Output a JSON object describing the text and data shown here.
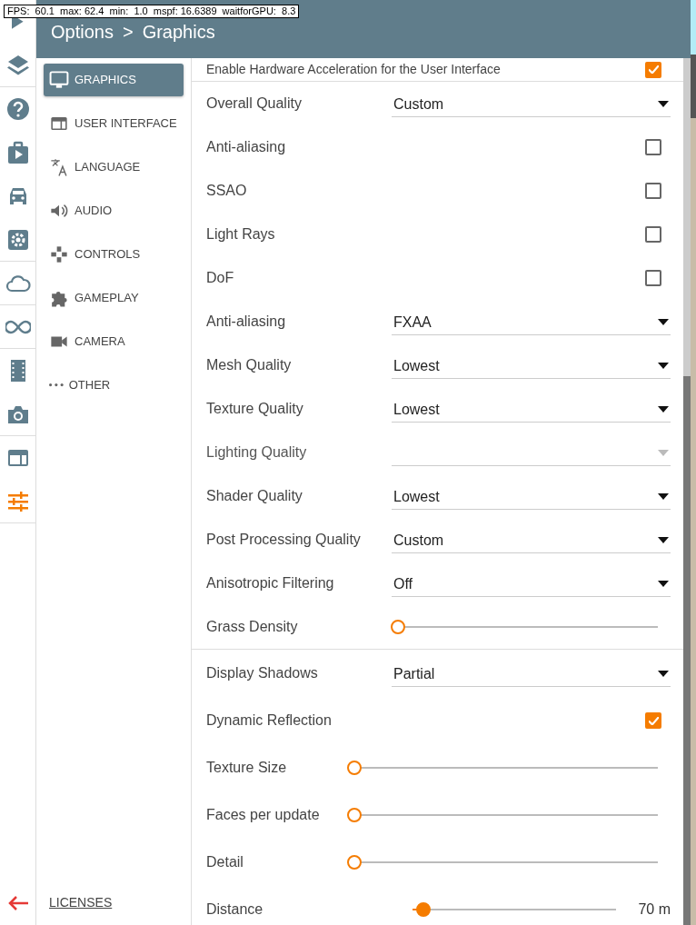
{
  "fps_overlay": "FPS:  60.1  max: 62.4  min:  1.0  mspf: 16.6389  waitforGPU:  8.3",
  "header": {
    "title": "Options",
    "separator": ">",
    "subtitle": "Graphics"
  },
  "rail": [
    {
      "selected": false
    },
    {
      "selected": false
    },
    {
      "selected": false
    },
    {
      "selected": false
    },
    {
      "selected": false
    },
    {
      "selected": false
    },
    {
      "selected": false
    },
    {
      "selected": false
    },
    {
      "selected": false
    },
    {
      "selected": false
    },
    {
      "selected": false
    },
    {
      "selected": true
    }
  ],
  "menu": [
    {
      "label": "GRAPHICS",
      "selected": true
    },
    {
      "label": "USER INTERFACE",
      "selected": false
    },
    {
      "label": "LANGUAGE",
      "selected": false
    },
    {
      "label": "AUDIO",
      "selected": false
    },
    {
      "label": "CONTROLS",
      "selected": false
    },
    {
      "label": "GAMEPLAY",
      "selected": false
    },
    {
      "label": "CAMERA",
      "selected": false
    },
    {
      "label": "OTHER",
      "selected": false
    }
  ],
  "licenses": "LICENSES",
  "sections": [
    {
      "settings": [
        {
          "kind": "checkbox",
          "label": "Enable Hardware Acceleration for the User Interface",
          "checked": true
        },
        {
          "kind": "select",
          "label": "Overall Quality",
          "value": "Custom",
          "disabled": false
        },
        {
          "kind": "checkbox",
          "label": "Anti-aliasing",
          "checked": false
        },
        {
          "kind": "checkbox",
          "label": "SSAO",
          "checked": false
        },
        {
          "kind": "checkbox",
          "label": "Light Rays",
          "checked": false
        },
        {
          "kind": "checkbox",
          "label": "DoF",
          "checked": false
        },
        {
          "kind": "select",
          "label": "Anti-aliasing",
          "value": "FXAA",
          "disabled": false
        },
        {
          "kind": "select",
          "label": "Mesh Quality",
          "value": "Lowest",
          "disabled": false
        },
        {
          "kind": "select",
          "label": "Texture Quality",
          "value": "Lowest",
          "disabled": false
        },
        {
          "kind": "select",
          "label": "Lighting Quality",
          "disabled": true
        },
        {
          "kind": "select",
          "label": "Shader Quality",
          "value": "Lowest",
          "disabled": false
        },
        {
          "kind": "select",
          "label": "Post Processing Quality",
          "value": "Custom",
          "disabled": false
        },
        {
          "kind": "select",
          "label": "Anisotropic Filtering",
          "value": "Off",
          "disabled": false
        },
        {
          "kind": "slider",
          "label": "Grass Density",
          "level": 0
        }
      ]
    },
    {
      "settings": [
        {
          "kind": "select",
          "label": "Display Shadows",
          "value": "Partial",
          "disabled": false
        },
        {
          "kind": "checkbox",
          "label": "Dynamic Reflection",
          "checked": true
        },
        {
          "kind": "slider",
          "label": "Texture Size",
          "level": 0
        },
        {
          "kind": "slider",
          "label": "Faces per update",
          "level": 0
        },
        {
          "kind": "slider",
          "label": "Detail",
          "level": 0
        },
        {
          "kind": "slider",
          "label": "Distance",
          "level": 0.05,
          "reading": "70 m"
        }
      ]
    }
  ]
}
